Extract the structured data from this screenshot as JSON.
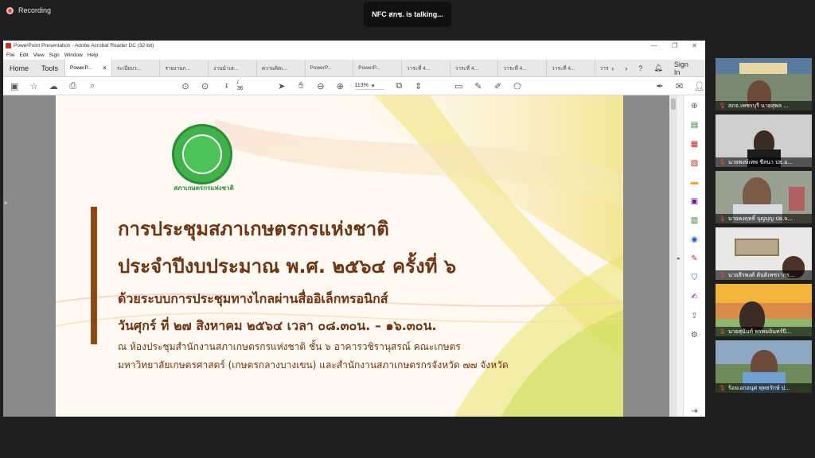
{
  "meeting": {
    "recording_label": "Recording",
    "talking_label": "NFC สกช. is talking..."
  },
  "window": {
    "title": "PowerPoint Presentation - Adobe Acrobat Reader DC (32-bit)",
    "controls": [
      "—",
      "❐",
      "✕"
    ]
  },
  "menu": [
    "File",
    "Edit",
    "View",
    "Sign",
    "Window",
    "Help"
  ],
  "tabs": {
    "home": "Home",
    "tools": "Tools",
    "items": [
      {
        "label": "PowerP...",
        "active": true
      },
      {
        "label": "ระเบียบว...",
        "active": false
      },
      {
        "label": "รายงานก...",
        "active": false
      },
      {
        "label": "งานนำเส...",
        "active": false
      },
      {
        "label": "ความคิดเ...",
        "active": false
      },
      {
        "label": "PowerP...",
        "active": false
      },
      {
        "label": "PowerP...",
        "active": false
      },
      {
        "label": "วาระที่ 4...",
        "active": false
      },
      {
        "label": "วาระที่ 4...",
        "active": false
      },
      {
        "label": "วาระที่ 4...",
        "active": false
      },
      {
        "label": "วาระที่ 4...",
        "active": false
      },
      {
        "label": "วาร",
        "active": false
      }
    ],
    "sign_in": "Sign In"
  },
  "toolbar": {
    "page_current": "1",
    "page_total": "/ 36",
    "zoom": "113%"
  },
  "slide": {
    "logo_text": "สภาเกษตรกรแห่งชาติ",
    "line1": "การประชุมสภาเกษตรกรแห่งชาติ",
    "line2": "ประจำปีงบประมาณ พ.ศ. ๒๕๖๔ ครั้งที่ ๖",
    "line3": "ด้วยระบบการประชุมทางไกลผ่านสื่ออิเล็กทรอนิกส์",
    "line4": "วันศุกร์ ที่ ๒๗ สิงหาคม ๒๕๖๔ เวลา ๐๘.๓๐น. – ๑๖.๓๐น.",
    "line5": "ณ ห้องประชุมสำนักงานสภาเกษตรกรแห่งชาติ ชั้น ๖ อาคารวชิรานุสรณ์ คณะเกษตร",
    "line6": "มหาวิทยาลัยเกษตรศาสตร์ (เกษตรกลางบางเขน) และสำนักงานสภาเกษตรกรจังหวัด ๗๗ จังหวัด"
  },
  "participants": [
    {
      "name": "สภจ.เพชรบุรี นายสุพล ..."
    },
    {
      "name": "นายพงษ์เทพ ชีสนา ปธ.อ..."
    },
    {
      "name": "นายคงฤทธิ์ บุญบุญ ปธ.จ..."
    },
    {
      "name": "นายธีรพงศ์ ตันติเพชรากร..."
    },
    {
      "name": "นายสุนันท์ พรหมอินทร์ปี..."
    },
    {
      "name": "ร้อยเอกอนุศ พุทธรักษ์ ป..."
    }
  ]
}
